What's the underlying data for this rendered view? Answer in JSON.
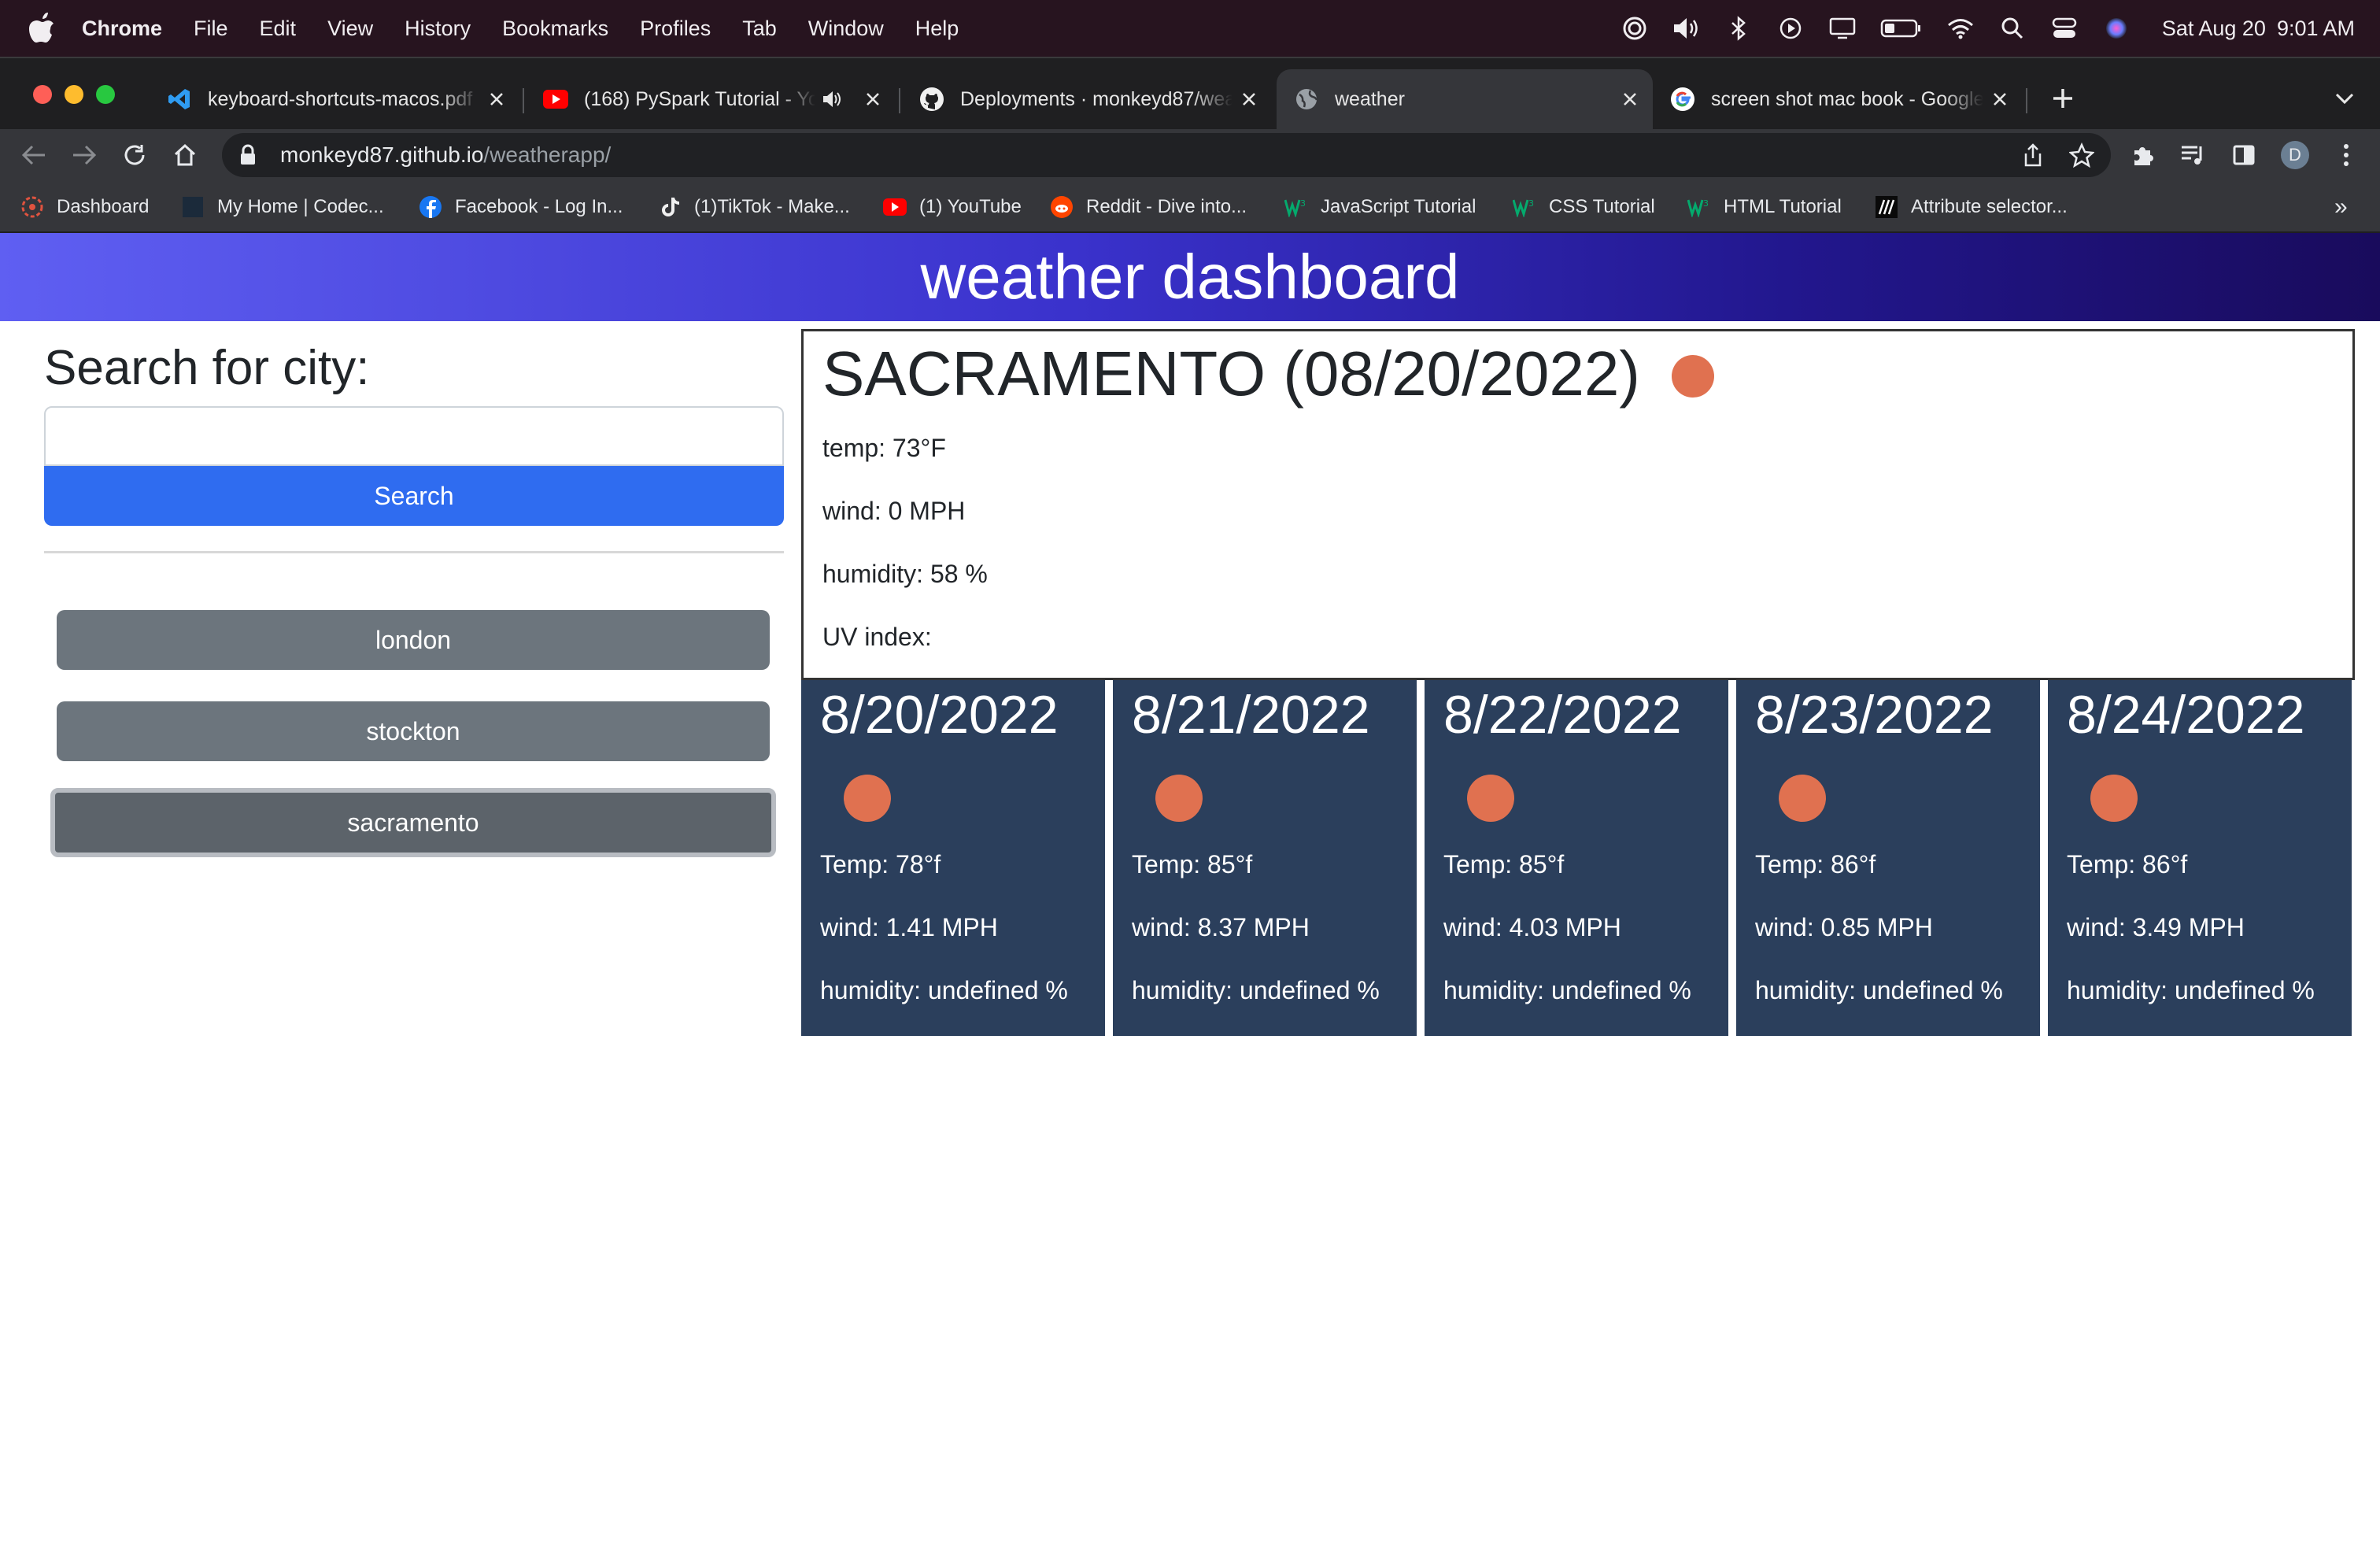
{
  "menubar": {
    "app": "Chrome",
    "items": [
      "File",
      "Edit",
      "View",
      "History",
      "Bookmarks",
      "Profiles",
      "Tab",
      "Window",
      "Help"
    ],
    "date": "Sat Aug 20",
    "time": "9:01 AM"
  },
  "browser": {
    "tabs": [
      {
        "title": "keyboard-shortcuts-macos.pdf",
        "icon": "vscode-icon"
      },
      {
        "title": "(168) PySpark Tutorial - YouTube",
        "icon": "youtube-icon",
        "audio": true
      },
      {
        "title": "Deployments · monkeyd87/weatherapp",
        "icon": "github-icon"
      },
      {
        "title": "weather",
        "icon": "globe-icon",
        "active": true
      },
      {
        "title": "screen shot mac book - Google Search",
        "icon": "google-icon"
      }
    ],
    "address": {
      "host": "monkeyd87.github.io",
      "path": "/weatherapp/"
    },
    "profile_initial": "D",
    "bookmarks": [
      {
        "label": "Dashboard",
        "icon": "dashboard-icon"
      },
      {
        "label": "My Home | Codec...",
        "icon": "codecademy-icon"
      },
      {
        "label": "Facebook - Log In...",
        "icon": "facebook-icon"
      },
      {
        "label": "(1)TikTok - Make...",
        "icon": "tiktok-icon"
      },
      {
        "label": "(1) YouTube",
        "icon": "youtube-icon"
      },
      {
        "label": "Reddit - Dive into...",
        "icon": "reddit-icon"
      },
      {
        "label": "JavaScript Tutorial",
        "icon": "w3schools-icon"
      },
      {
        "label": "CSS Tutorial",
        "icon": "w3schools-icon"
      },
      {
        "label": "HTML Tutorial",
        "icon": "w3schools-icon"
      },
      {
        "label": "Attribute selector...",
        "icon": "mdn-icon"
      }
    ],
    "bookmarks_overflow": "»"
  },
  "page": {
    "header": "weather dashboard",
    "sidebar": {
      "heading": "Search for city:",
      "search_value": "",
      "search_button": "Search",
      "history": [
        "london",
        "stockton",
        "sacramento"
      ]
    },
    "current": {
      "title": "SACRAMENTO (08/20/2022)",
      "temp": "temp: 73°F",
      "wind": "wind: 0 MPH",
      "humidity": "humidity: 58 %",
      "uv": "UV index:"
    },
    "forecast": [
      {
        "date": "8/20/2022",
        "temp": "Temp: 78°f",
        "wind": "wind: 1.41 MPH",
        "humidity": "humidity: undefined %"
      },
      {
        "date": "8/21/2022",
        "temp": "Temp: 85°f",
        "wind": "wind: 8.37 MPH",
        "humidity": "humidity: undefined %"
      },
      {
        "date": "8/22/2022",
        "temp": "Temp: 85°f",
        "wind": "wind: 4.03 MPH",
        "humidity": "humidity: undefined %"
      },
      {
        "date": "8/23/2022",
        "temp": "Temp: 86°f",
        "wind": "wind: 0.85 MPH",
        "humidity": "humidity: undefined %"
      },
      {
        "date": "8/24/2022",
        "temp": "Temp: 86°f",
        "wind": "wind: 3.49 MPH",
        "humidity": "humidity: undefined %"
      }
    ],
    "colors": {
      "header_start": "#5f5ff2",
      "header_end": "#190b5c",
      "search_button": "#2f6cf0",
      "history_button": "#6c757d",
      "forecast_card": "#2b3f5c",
      "weather_icon": "#e07150"
    }
  }
}
